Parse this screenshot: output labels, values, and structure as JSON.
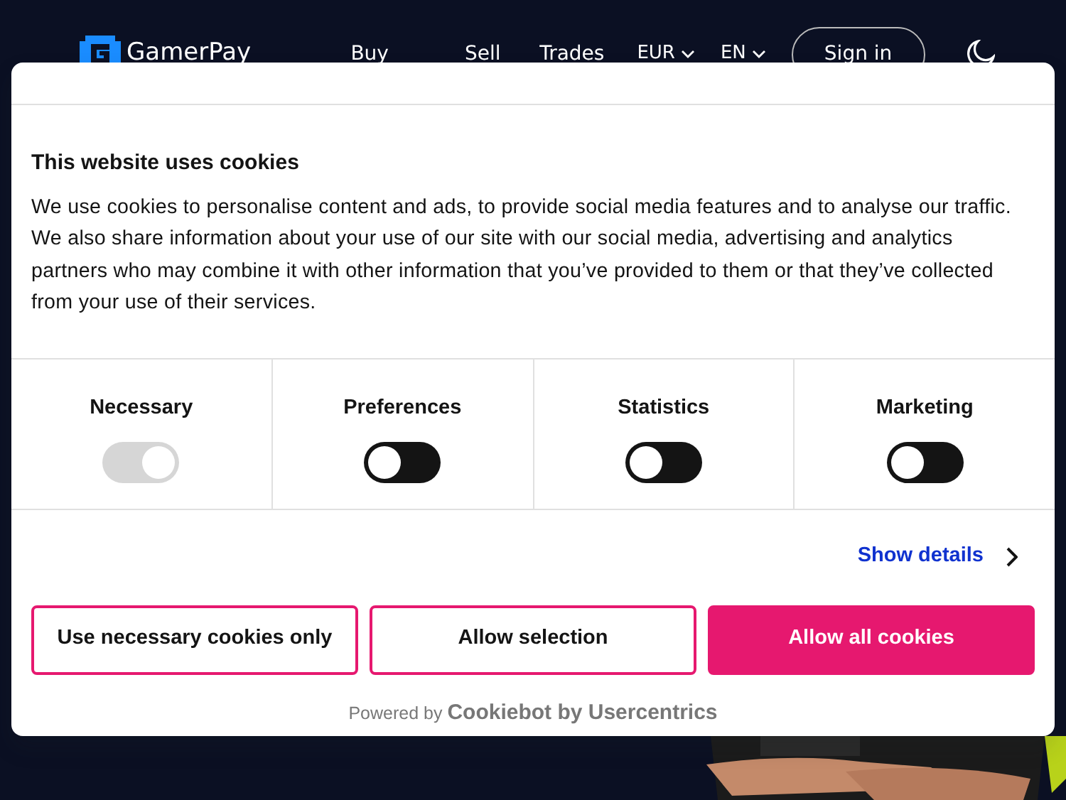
{
  "header": {
    "logo": "GamerPay",
    "nav": [
      "Buy",
      "Sell",
      "Trades"
    ],
    "currency": "EUR",
    "language": "EN",
    "sign_in": "Sign in"
  },
  "dialog": {
    "title": "This website uses cookies",
    "text": "We use cookies to personalise content and ads, to provide social media features and to analyse our traffic. We also share information about your use of our site with our social media, advertising and analytics partners who may combine it with other information that you’ve provided to them or that they’ve collected from your use of their services.",
    "categories": [
      {
        "label": "Necessary",
        "on": true,
        "disabled": true
      },
      {
        "label": "Preferences",
        "on": false,
        "disabled": false
      },
      {
        "label": "Statistics",
        "on": false,
        "disabled": false
      },
      {
        "label": "Marketing",
        "on": false,
        "disabled": false
      }
    ],
    "show_details": "Show details",
    "buttons": [
      {
        "label": "Use necessary cookies only",
        "kind": "outline"
      },
      {
        "label": "Allow selection",
        "kind": "outline"
      },
      {
        "label": "Allow all cookies",
        "kind": "filled"
      }
    ],
    "powered_by": "Powered by **Cookiebot by Usercentrics**"
  }
}
